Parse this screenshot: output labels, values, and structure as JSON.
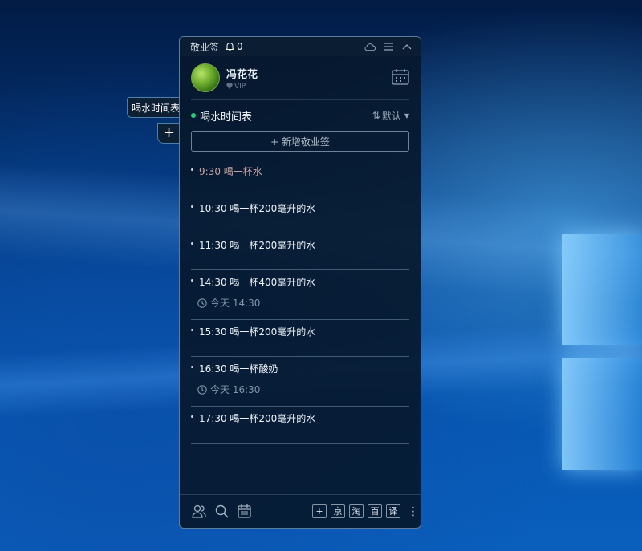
{
  "side_tab": {
    "label": "喝水时间表",
    "add_label": "+"
  },
  "titlebar": {
    "app_name": "敬业签",
    "notification_count": "0"
  },
  "user": {
    "name": "冯花花",
    "badge": "VIP"
  },
  "list": {
    "title": "喝水时间表",
    "sort_icon": "⇅",
    "sort_label": "默认",
    "add_button": "+ 新增敬业签",
    "status_color": "#2dc77a"
  },
  "items": [
    {
      "text": "9:30 喝一杯水",
      "done": true
    },
    {
      "text": "10:30 喝一杯200毫升的水"
    },
    {
      "text": "11:30 喝一杯200毫升的水"
    },
    {
      "text": "14:30 喝一杯400毫升的水",
      "remind": "今天 14:30"
    },
    {
      "text": "15:30 喝一杯200毫升的水"
    },
    {
      "text": "16:30 喝一杯酸奶",
      "remind": "今天 16:30"
    },
    {
      "text": "17:30 喝一杯200毫升的水"
    }
  ],
  "footer": {
    "icons": [
      "contacts-icon",
      "search-icon",
      "calendar-icon"
    ],
    "shortcuts": [
      "+",
      "京",
      "淘",
      "百",
      "译"
    ],
    "more": "⋮"
  }
}
